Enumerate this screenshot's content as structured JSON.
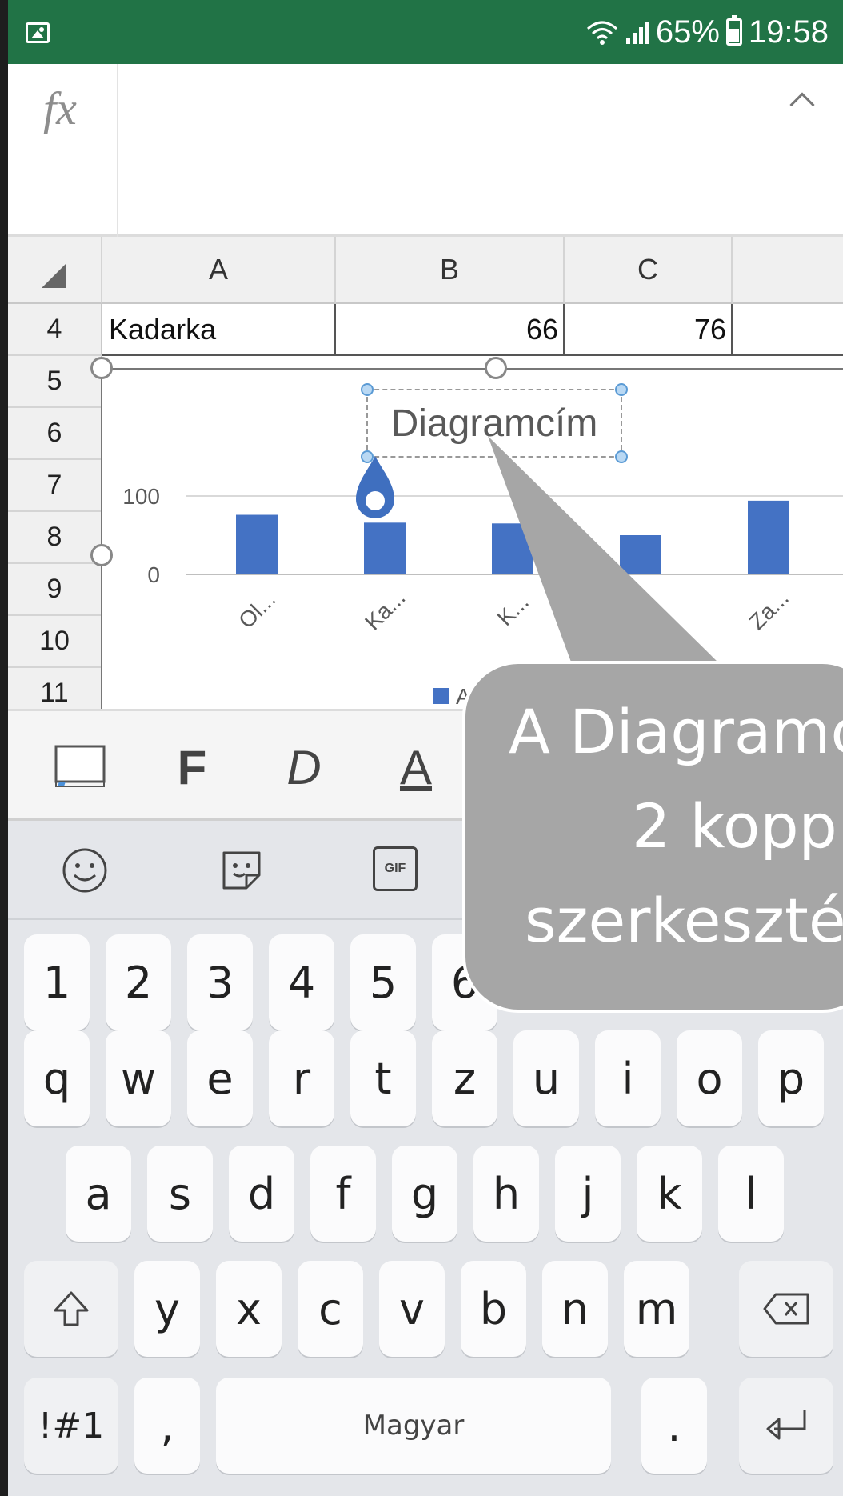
{
  "status_bar": {
    "battery": "65%",
    "time": "19:58"
  },
  "formula_bar": {
    "fx_label": "fx"
  },
  "grid": {
    "columns": [
      "A",
      "B",
      "C"
    ],
    "rows": [
      "4",
      "5",
      "6",
      "7",
      "8",
      "9",
      "10",
      "11"
    ],
    "row4": {
      "a": "Kadarka",
      "b": "66",
      "c": "76"
    }
  },
  "chart_data": {
    "type": "bar",
    "title": "Diagramcím",
    "categories": [
      "Ol...",
      "Ka...",
      "K...",
      "...",
      "Za..."
    ],
    "values": [
      76,
      66,
      65,
      50,
      94
    ],
    "yticks": [
      "100",
      "0"
    ],
    "ylim": [
      0,
      100
    ],
    "legend_partial": "A",
    "bar_color": "#4472c4"
  },
  "format_toolbar": {
    "bold": "F",
    "italic": "D",
    "underline": "A"
  },
  "keyboard": {
    "numbers": [
      "1",
      "2",
      "3",
      "4",
      "5",
      "6"
    ],
    "row1": [
      "q",
      "w",
      "e",
      "r",
      "t",
      "z",
      "u",
      "i",
      "o",
      "p"
    ],
    "row2": [
      "a",
      "s",
      "d",
      "f",
      "g",
      "h",
      "j",
      "k",
      "l"
    ],
    "row3": [
      "y",
      "x",
      "c",
      "v",
      "b",
      "n",
      "m"
    ],
    "symbols_label": "!#1",
    "comma": ",",
    "space_label": "Magyar",
    "period": ".",
    "gif_label": "GIF"
  },
  "callout": {
    "line1": "A Diagramc",
    "line2": "2 kopp",
    "line3": "szerkeszté"
  },
  "colors": {
    "excel_green": "#217346",
    "callout_gray": "#a6a6a6"
  }
}
